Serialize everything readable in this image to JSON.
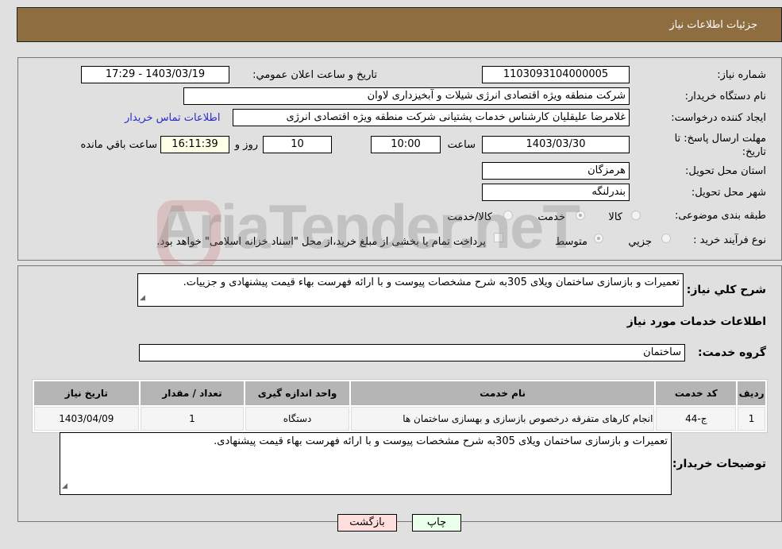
{
  "header": {
    "title": "جزئیات اطلاعات نیاز"
  },
  "details": {
    "need_number_label": "شماره نیاز:",
    "need_number": "1103093104000005",
    "announce_label": "تاریخ و ساعت اعلان عمومي:",
    "announce_value": "1403/03/19 - 17:29",
    "buyer_org_label": "نام دستگاه خریدار:",
    "buyer_org": "شرکت منطقه ویژه اقتصادی انرژی شیلات و آبخیزداری لاوان",
    "creator_label": "ایجاد کننده درخواست:",
    "creator": "غلامرضا علیقلیان کارشناس خدمات پشتیانی شرکت منطقه ویژه اقتصادی انرژی",
    "contact_link": "اطلاعات تماس خریدار",
    "deadline_label": "مهلت ارسال پاسخ: تا تاریخ:",
    "deadline_date": "1403/03/30",
    "time_label": "ساعت",
    "deadline_time": "10:00",
    "days_value": "10",
    "days_label": "روز و",
    "remaining_time": "16:11:39",
    "remaining_label": "ساعت باقي مانده",
    "province_label": "استان محل تحویل:",
    "province": "هرمزگان",
    "city_label": "شهر محل تحویل:",
    "city": "بندرلنگه",
    "category_label": "طبقه بندی موضوعی:",
    "category_options": [
      "کالا",
      "خدمت",
      "کالا/خدمت"
    ],
    "category_selected": "خدمت",
    "process_label": "نوع فرآیند خرید :",
    "process_options": [
      "جزيي",
      "متوسط"
    ],
    "process_selected": "متوسط",
    "treasury_note": "پرداخت تمام یا بخشی از مبلغ خرید،از محل \"اسناد خزانه اسلامی\" خواهد بود."
  },
  "description": {
    "label": "شرح كلي نياز:",
    "text": "تعمیرات و بازسازی ساختمان ویلای 305به شرح مشخصات پیوست و با ارائه فهرست بهاء قیمت پیشنهادی و جزییات."
  },
  "services": {
    "section_title": "اطلاعات خدمات مورد نیاز",
    "group_label": "گروه خدمت:",
    "group_value": "ساختمان",
    "columns": [
      "ردیف",
      "کد خدمت",
      "نام خدمت",
      "واحد اندازه گیری",
      "تعداد / مقدار",
      "تاریخ نیاز"
    ],
    "rows": [
      [
        "1",
        "ج-44",
        "انجام کارهای متفرقه درخصوص بازسازی و بهسازی ساختمان ها",
        "دستگاه",
        "1",
        "1403/04/09"
      ]
    ]
  },
  "buyer_notes": {
    "label": "توضیحات خریدار:",
    "text": "تعمیرات و بازسازی ساختمان ویلای 305به شرح مشخصات پیوست و با ارائه فهرست بهاء قیمت پیشنهادی."
  },
  "buttons": {
    "print": "چاپ",
    "back": "بازگشت"
  },
  "watermark": "AriaTender.neT"
}
